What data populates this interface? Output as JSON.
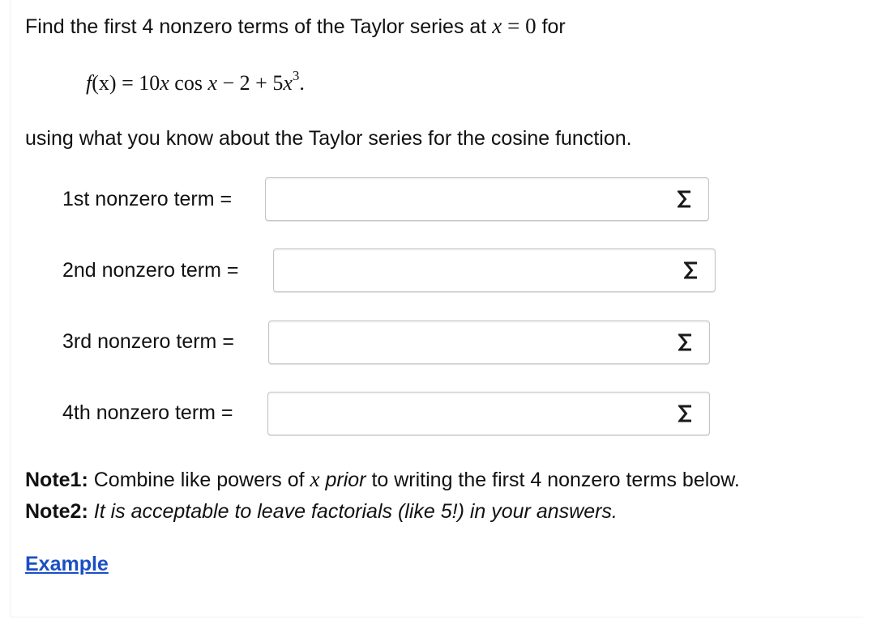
{
  "question": {
    "intro_prefix": "Find the first 4 nonzero terms of the Taylor series at",
    "at_variable": "x",
    "at_equals": "= 0",
    "intro_suffix": "for",
    "formula": {
      "lhs_func": "f",
      "lhs_arg": "(x)",
      "equals": "=",
      "term1_coef": "10",
      "term1_var": "x",
      "term1_func": "cos",
      "term1_arg": "x",
      "minus": "−",
      "constant": "2",
      "plus": "+",
      "term3_coef": "5",
      "term3_var": "x",
      "term3_power": "3",
      "end": "."
    },
    "instruction": "using what you know about the Taylor series for the cosine function."
  },
  "answers": [
    {
      "label": "1st nonzero term =",
      "value": "",
      "button_icon": "sigma-icon"
    },
    {
      "label": "2nd nonzero term =",
      "value": "",
      "button_icon": "sigma-icon"
    },
    {
      "label": "3rd nonzero term =",
      "value": "",
      "button_icon": "sigma-icon"
    },
    {
      "label": "4th nonzero term =",
      "value": "",
      "button_icon": "sigma-icon"
    }
  ],
  "notes": {
    "note1_label": "Note1:",
    "note1_text_before": "Combine like powers of",
    "note1_var": "x",
    "note1_emphasis": "prior",
    "note1_text_after": "to writing the first 4 nonzero terms below.",
    "note2_label": "Note2:",
    "note2_text": "It is acceptable to leave factorials (like 5!) in your answers."
  },
  "example_link": "Example",
  "colors": {
    "link": "#1a4fc4",
    "text": "#111111",
    "box_border": "#c5c5c5"
  }
}
